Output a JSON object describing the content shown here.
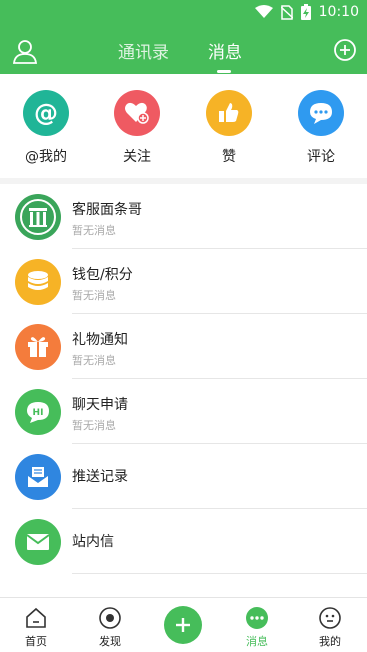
{
  "status_bar": {
    "time": "10:10"
  },
  "header": {
    "tabs": [
      {
        "label": "通讯录"
      },
      {
        "label": "消息"
      }
    ]
  },
  "quick_actions": [
    {
      "label": "@我的",
      "icon": "at-icon",
      "color": "#20b597"
    },
    {
      "label": "关注",
      "icon": "heart-plus-icon",
      "color": "#ef5a62"
    },
    {
      "label": "赞",
      "icon": "thumbs-up-icon",
      "color": "#f6b326"
    },
    {
      "label": "评论",
      "icon": "comment-icon",
      "color": "#2f9af0"
    }
  ],
  "messages": [
    {
      "title": "客服面条哥",
      "subtitle": "暂无消息",
      "icon": "service-logo-icon",
      "color": "#3aa55a"
    },
    {
      "title": "钱包/积分",
      "subtitle": "暂无消息",
      "icon": "coins-icon",
      "color": "#f6b326"
    },
    {
      "title": "礼物通知",
      "subtitle": "暂无消息",
      "icon": "gift-icon",
      "color": "#f47c3c"
    },
    {
      "title": "聊天申请",
      "subtitle": "暂无消息",
      "icon": "chat-hi-icon",
      "color": "#46bd5a"
    },
    {
      "title": "推送记录",
      "subtitle": "",
      "icon": "inbox-icon",
      "color": "#2f86e0"
    },
    {
      "title": "站内信",
      "subtitle": "",
      "icon": "mail-icon",
      "color": "#46bd5a"
    }
  ],
  "tab_bar": {
    "items": [
      {
        "label": "首页",
        "icon": "home-icon"
      },
      {
        "label": "发现",
        "icon": "discover-icon"
      },
      {
        "label": "",
        "icon": "add-icon"
      },
      {
        "label": "消息",
        "icon": "message-dots-icon"
      },
      {
        "label": "我的",
        "icon": "face-icon"
      }
    ],
    "active_color": "#46bd5a"
  }
}
